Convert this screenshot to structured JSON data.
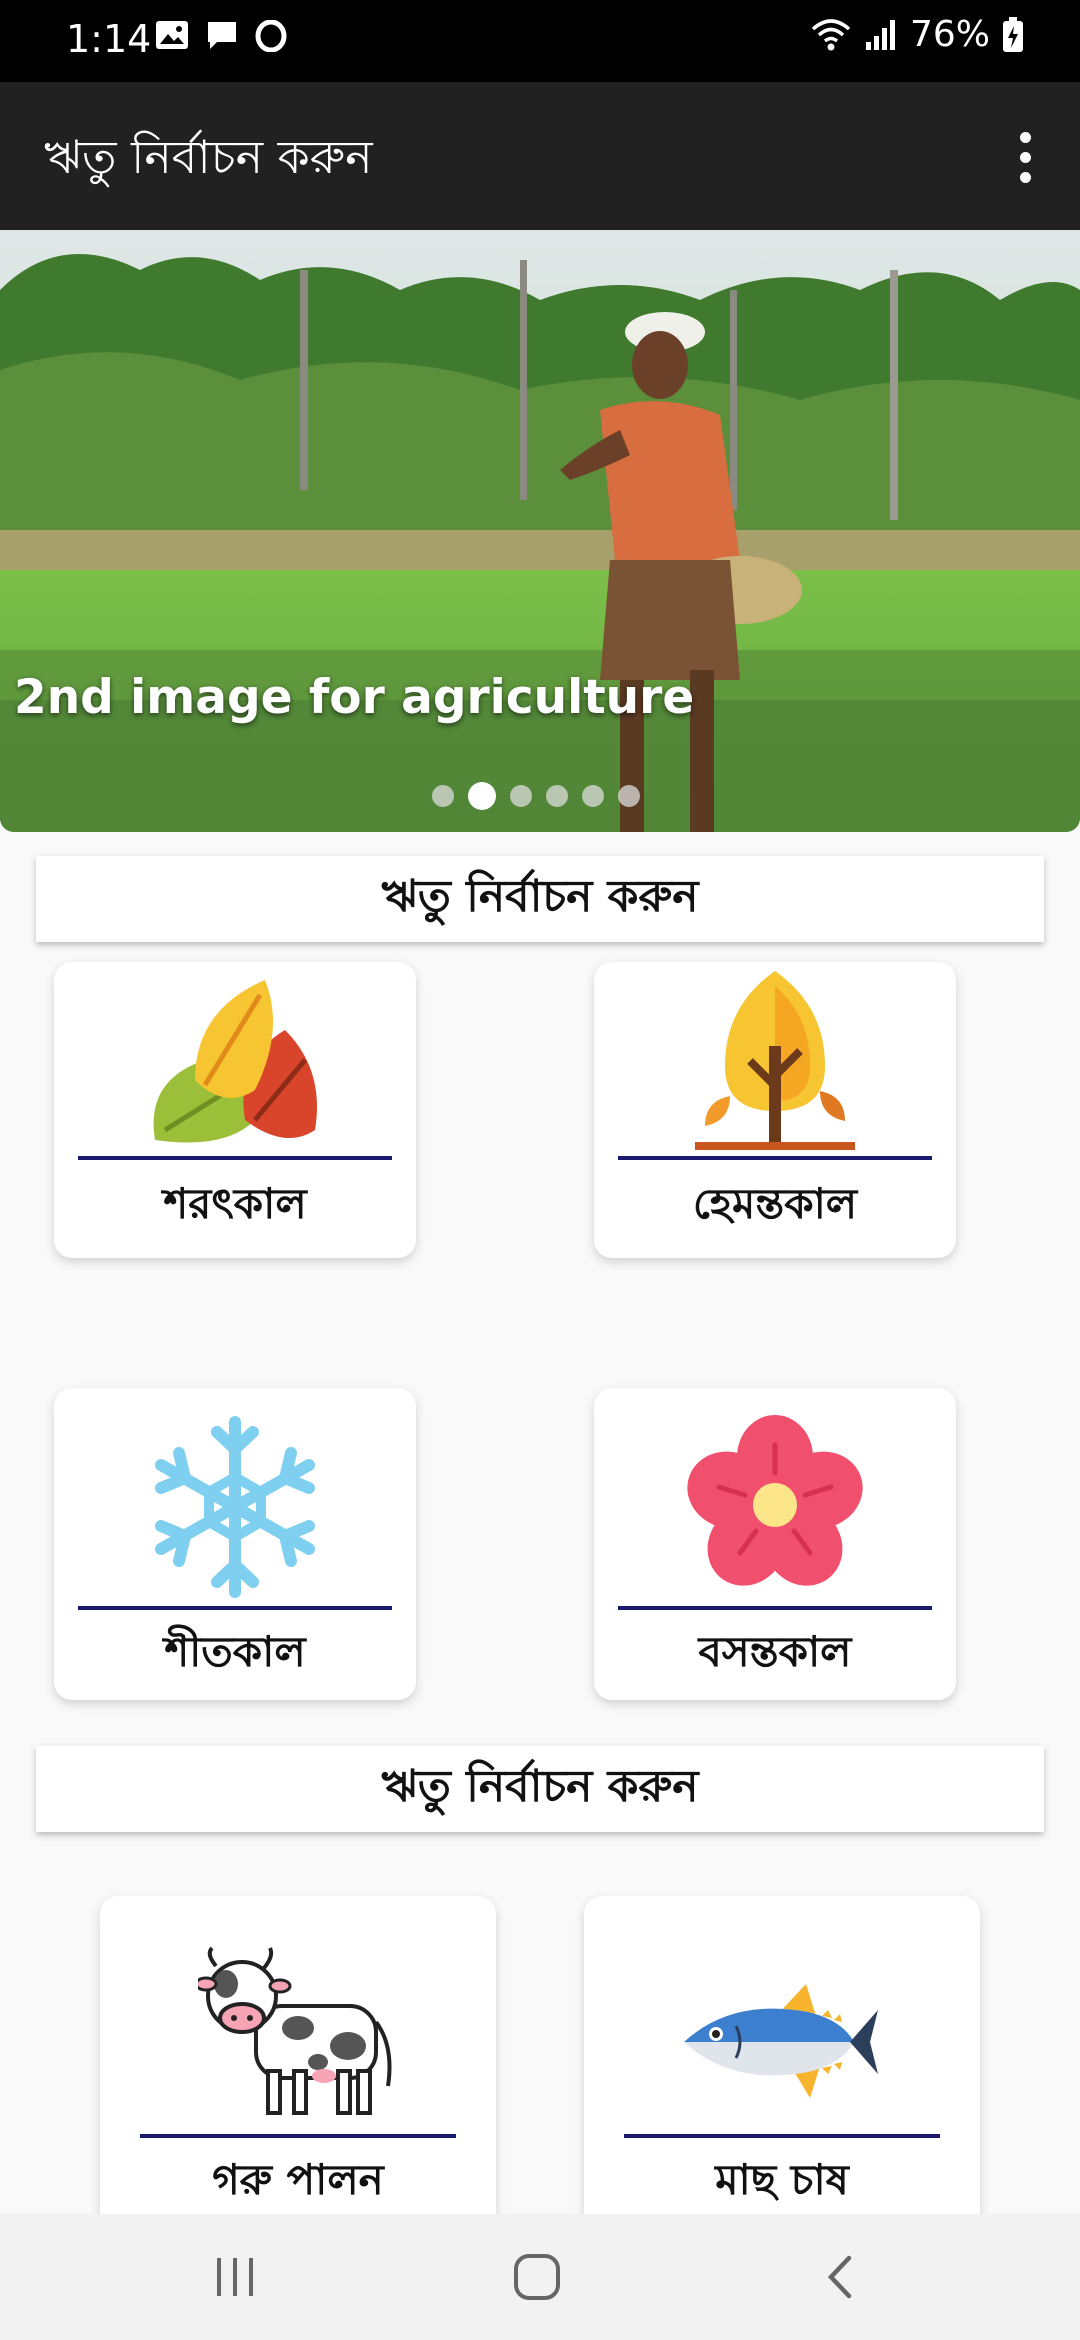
{
  "status_bar": {
    "time": "1:14",
    "battery": "76%"
  },
  "app_bar": {
    "title": "ঋতু নির্বাচন করুন",
    "menu_icon": "more-vert-icon"
  },
  "banner": {
    "caption": "2nd image for agriculture",
    "slide_count": 6,
    "active_slide": 2
  },
  "sections": [
    {
      "header": "ঋতু নির্বাচন করুন"
    },
    {
      "header": "ঋতু নির্বাচন করুন"
    }
  ],
  "seasons": [
    {
      "label": "শরৎকাল",
      "icon": "autumn-leaves-icon"
    },
    {
      "label": "হেমন্তকাল",
      "icon": "tree-icon"
    },
    {
      "label": "শীতকাল",
      "icon": "snowflake-icon"
    },
    {
      "label": "বসন্তকাল",
      "icon": "flower-icon"
    }
  ],
  "categories": [
    {
      "label": "গরু পালন",
      "icon": "cow-icon"
    },
    {
      "label": "মাছ চাষ",
      "icon": "fish-icon"
    }
  ],
  "colors": {
    "app_bar": "#212121",
    "rule": "#1a1a6e",
    "flower": "#f0506e",
    "snowflake": "#7fd0f0"
  }
}
